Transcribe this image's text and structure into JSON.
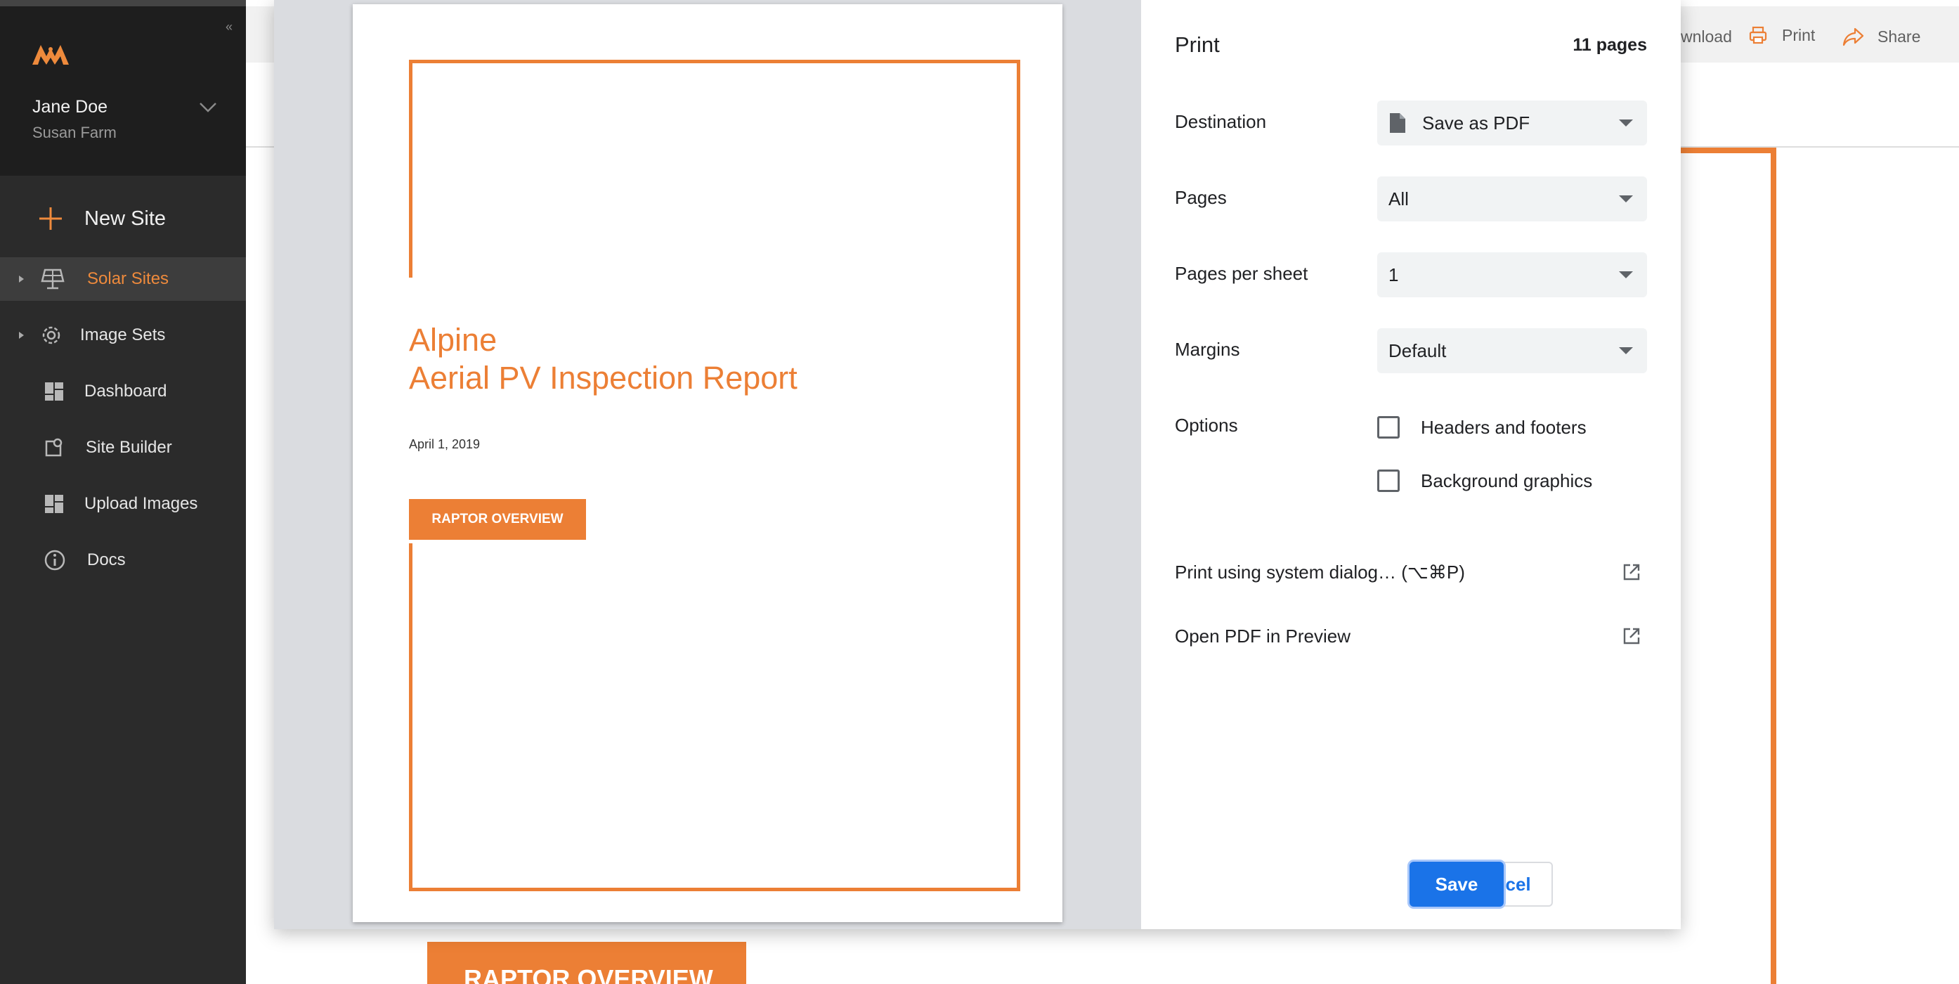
{
  "sidebar": {
    "user_name": "Jane Doe",
    "farm_name": "Susan Farm",
    "new_site_label": "New Site",
    "items": [
      {
        "label": "Solar Sites",
        "icon": "solar-panel-icon",
        "active": true,
        "expandable": true
      },
      {
        "label": "Image Sets",
        "icon": "gear-icon",
        "active": false,
        "expandable": true
      },
      {
        "label": "Dashboard",
        "icon": "dashboard-icon",
        "active": false,
        "expandable": false
      },
      {
        "label": "Site Builder",
        "icon": "map-pin-icon",
        "active": false,
        "expandable": false
      },
      {
        "label": "Upload Images",
        "icon": "dashboard-icon",
        "active": false,
        "expandable": false
      },
      {
        "label": "Docs",
        "icon": "info-icon",
        "active": false,
        "expandable": false
      }
    ],
    "accent_color": "#ee8a3c"
  },
  "header": {
    "download_label": "wnload",
    "print_label": "Print",
    "share_label": "Share"
  },
  "background": {
    "raptor_label": "RAPTOR OVERVIEW"
  },
  "preview": {
    "title_line1": "Alpine",
    "title_line2": "Aerial PV Inspection Report",
    "date": "April 1, 2019",
    "section_badge": "RAPTOR OVERVIEW",
    "brand_color": "#ec7f35"
  },
  "print_dialog": {
    "title": "Print",
    "page_count": "11 pages",
    "destination": {
      "label": "Destination",
      "value": "Save as PDF"
    },
    "pages": {
      "label": "Pages",
      "value": "All"
    },
    "pages_per_sheet": {
      "label": "Pages per sheet",
      "value": "1"
    },
    "margins": {
      "label": "Margins",
      "value": "Default"
    },
    "options": {
      "label": "Options",
      "headers_footers": {
        "label": "Headers and footers",
        "checked": false
      },
      "background_graphics": {
        "label": "Background graphics",
        "checked": false
      }
    },
    "system_dialog_label": "Print using system dialog… (⌥⌘P)",
    "open_pdf_label": "Open PDF in Preview",
    "cancel_label": "Cancel",
    "save_label": "Save",
    "primary_color": "#1a73e8"
  }
}
